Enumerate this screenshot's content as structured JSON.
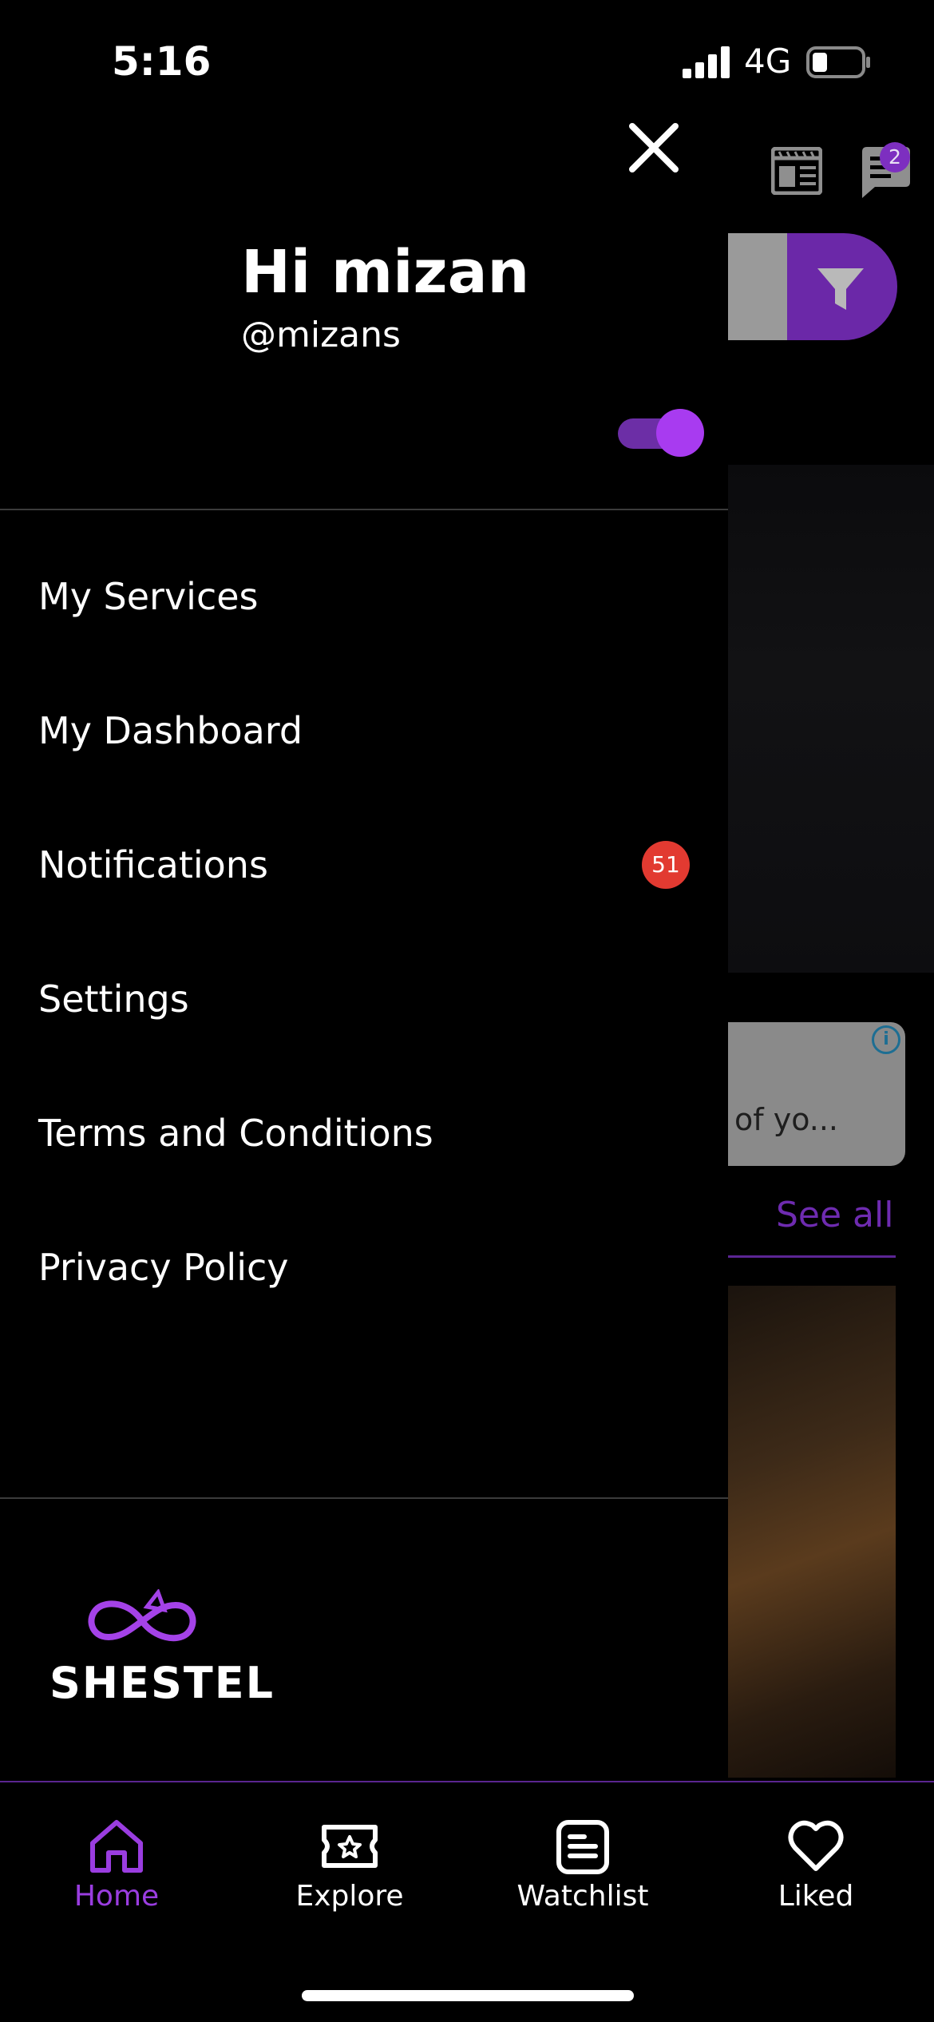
{
  "status_bar": {
    "time": "5:16",
    "network": "4G"
  },
  "background": {
    "chat_badge_count": "2",
    "ad_text": "of yo...",
    "see_all_label": "See all"
  },
  "drawer": {
    "greeting": "Hi mizan",
    "handle": "@mizans",
    "toggle_on": true,
    "menu": [
      {
        "label": "My Services"
      },
      {
        "label": "My Dashboard"
      },
      {
        "label": "Notifications",
        "badge": "51"
      },
      {
        "label": "Settings"
      },
      {
        "label": "Terms and Conditions"
      },
      {
        "label": "Privacy Policy"
      }
    ],
    "logo_text": "SHESTEL"
  },
  "bottom_nav": [
    {
      "label": "Home",
      "icon": "home-icon",
      "active": true
    },
    {
      "label": "Explore",
      "icon": "ticket-star-icon"
    },
    {
      "label": "Watchlist",
      "icon": "list-icon"
    },
    {
      "label": "Liked",
      "icon": "heart-icon"
    }
  ],
  "colors": {
    "accent": "#9a3de0",
    "toggle_track": "#6c2ea6",
    "badge_red": "#e23a31",
    "filter_purple": "#6b28a8"
  }
}
